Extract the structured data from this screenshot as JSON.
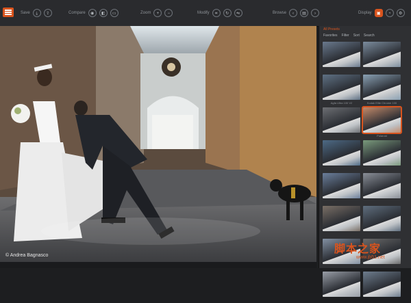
{
  "toolbar": {
    "save_label": "Save",
    "compare_label": "Compare",
    "zoom_label": "Zoom",
    "modify_label": "Modify",
    "browse_label": "Browse",
    "display_label": "Display"
  },
  "photo": {
    "credit": "© Andrea Bagnasco"
  },
  "panel": {
    "title": "All Presets",
    "tabs": [
      "Favorites",
      "Filter",
      "Sort",
      "Search"
    ],
    "presets": [
      {
        "label": "",
        "selected": false
      },
      {
        "label": "",
        "selected": false
      },
      {
        "label": "Agfa Ultra 100 V2",
        "selected": false
      },
      {
        "label": "Kodak Elite Chrome 100",
        "selected": false
      },
      {
        "label": "",
        "selected": false
      },
      {
        "label": "Polaroid",
        "selected": true
      },
      {
        "label": "",
        "selected": false
      },
      {
        "label": "",
        "selected": false
      },
      {
        "label": "",
        "selected": false
      },
      {
        "label": "",
        "selected": false
      },
      {
        "label": "",
        "selected": false
      },
      {
        "label": "",
        "selected": false
      },
      {
        "label": "",
        "selected": false
      },
      {
        "label": "",
        "selected": false
      },
      {
        "label": "",
        "selected": false
      },
      {
        "label": "",
        "selected": false
      }
    ]
  },
  "watermark": {
    "text": "脚本之家",
    "url": "www.jb51.net"
  },
  "colors": {
    "accent": "#d9541e",
    "toolbar": "#2a2b2e",
    "panel": "#2f3033"
  }
}
